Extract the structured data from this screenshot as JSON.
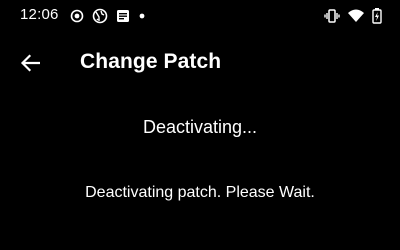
{
  "status_bar": {
    "time": "12:06",
    "left_icons": [
      "target-icon",
      "world-icon",
      "notes-icon",
      "dot-icon"
    ],
    "right_icons": [
      "vibrate-icon",
      "wifi-icon",
      "battery-charging-icon"
    ]
  },
  "app_bar": {
    "back_icon": "arrow-left-icon",
    "title": "Change Patch"
  },
  "content": {
    "heading": "Deactivating...",
    "message": "Deactivating patch. Please Wait."
  },
  "colors": {
    "background": "#000000",
    "foreground": "#ffffff"
  }
}
